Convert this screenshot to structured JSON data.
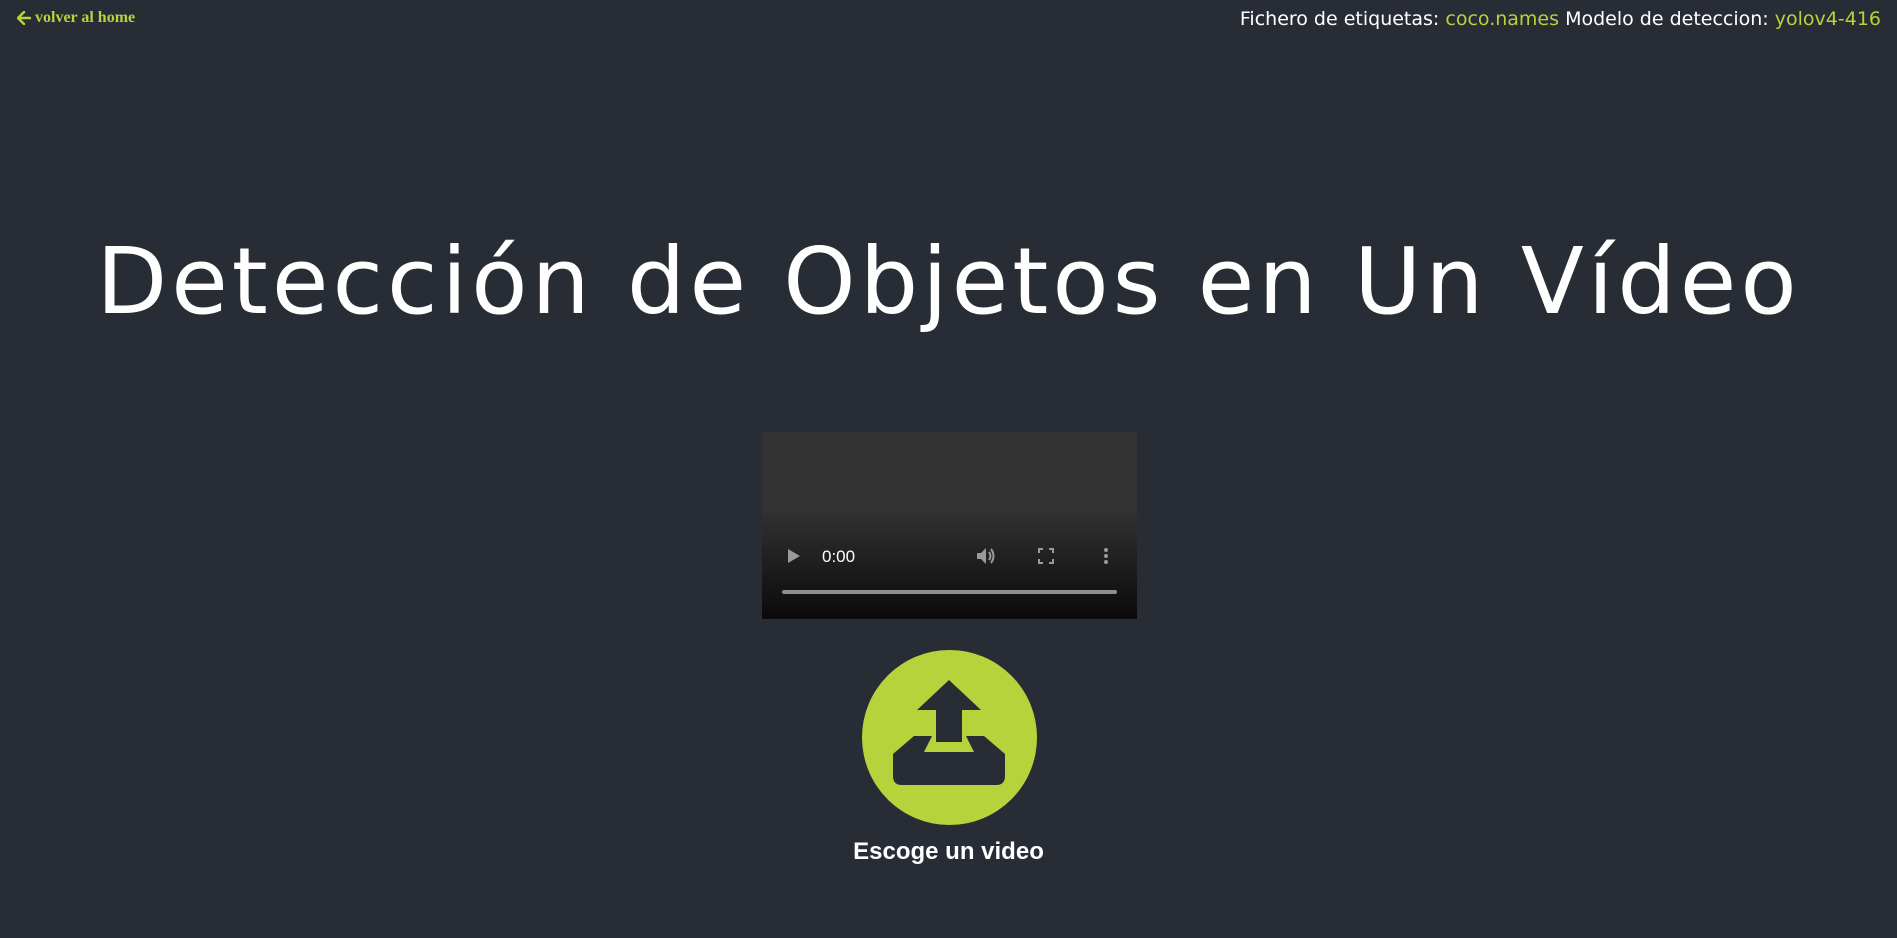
{
  "nav": {
    "back_label": "volver al home",
    "back_icon": "arrow-left-icon"
  },
  "info": {
    "labels_prefix": "Fichero de etiquetas:",
    "labels_value": "coco.names",
    "model_prefix": "Modelo de deteccion:",
    "model_value": "yolov4-416"
  },
  "main": {
    "title": "Detección de Objetos en Un Vídeo"
  },
  "video": {
    "time": "0:00",
    "icons": [
      "play-icon",
      "volume-icon",
      "fullscreen-icon",
      "more-vert-icon"
    ]
  },
  "upload": {
    "icon": "upload-icon",
    "label": "Escoge un video"
  },
  "colors": {
    "background": "#282c35",
    "accent": "#b7d23a",
    "text": "#ffffff"
  }
}
